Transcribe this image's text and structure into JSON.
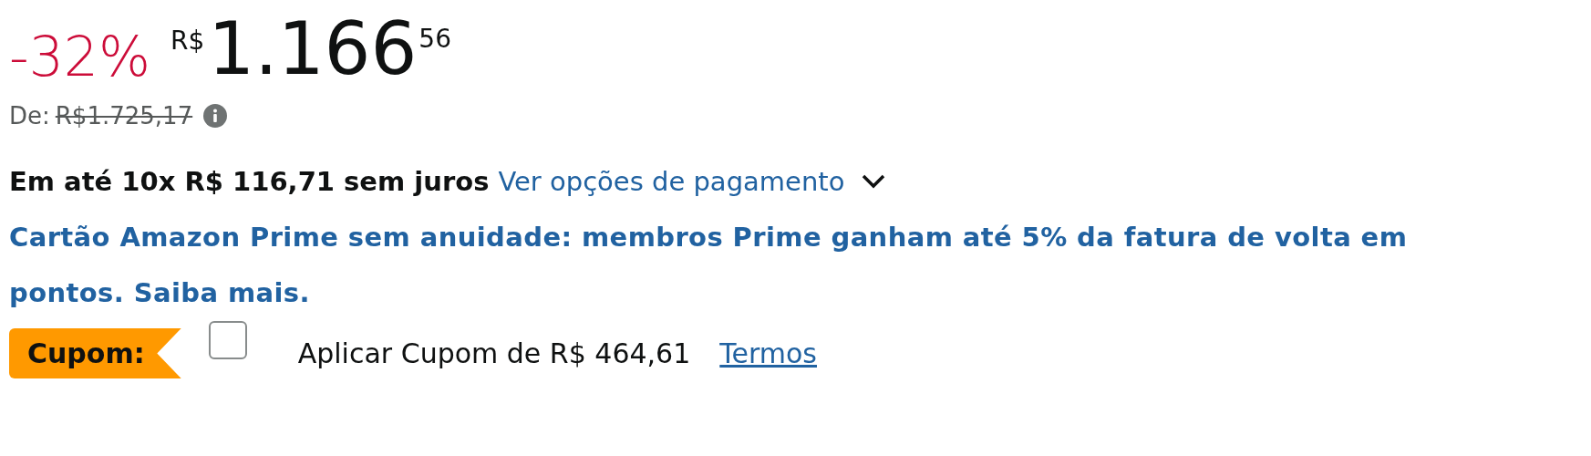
{
  "price": {
    "discount": "-32%",
    "currency": "R$",
    "whole": "1.166",
    "cents": "56"
  },
  "list_price": {
    "label": "De:",
    "value": "R$1.725,17"
  },
  "installments": {
    "text": "Em até 10x R$ 116,71 sem juros",
    "link": "Ver opções de pagamento"
  },
  "promo": {
    "text": "Cartão Amazon Prime sem anuidade: membros Prime ganham até 5% da fatura de volta em pontos. Saiba mais."
  },
  "coupon": {
    "badge": "Cupom:",
    "checked": false,
    "label": "Aplicar Cupom de R$ 464,61",
    "terms": "Termos"
  }
}
